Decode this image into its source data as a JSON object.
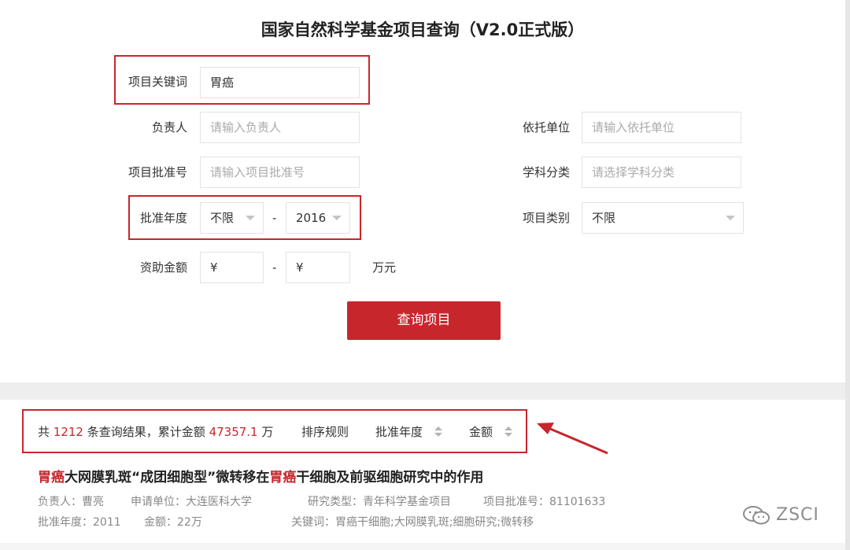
{
  "page": {
    "title": "国家自然科学基金项目查询（V2.0正式版）"
  },
  "form": {
    "keyword_label": "项目关键词",
    "keyword_value": "胃癌",
    "leader_label": "负责人",
    "leader_placeholder": "请输入负责人",
    "org_label": "依托单位",
    "org_placeholder": "请输入依托单位",
    "approval_no_label": "项目批准号",
    "approval_no_placeholder": "请输入项目批准号",
    "subject_label": "学科分类",
    "subject_placeholder": "请选择学科分类",
    "year_label": "批准年度",
    "year_from": "不限",
    "year_dash": "-",
    "year_to": "2016",
    "type_label": "项目类别",
    "type_value": "不限",
    "amount_label": "资助金额",
    "amount_from": "¥",
    "amount_dash": "-",
    "amount_to": "¥",
    "amount_unit": "万元",
    "submit_label": "查询项目"
  },
  "summary": {
    "prefix": "共",
    "count": "1212",
    "mid": "条查询结果，累计金额",
    "total": "47357.1",
    "suffix": "万",
    "sort_rule": "排序规则",
    "sort_year": "批准年度",
    "sort_amount": "金额"
  },
  "result": {
    "title_hl1": "胃癌",
    "title_part1": "大网膜乳斑“成团细胞型”微转移在",
    "title_hl2": "胃癌",
    "title_part2": "干细胞及前驱细胞研究中的作用",
    "leader": "负责人：曹亮",
    "org": "申请单位：大连医科大学",
    "research_type": "研究类型：青年科学基金项目",
    "approval_no": "项目批准号：81101633",
    "year": "批准年度：2011",
    "amount": "金额：22万",
    "keywords": "关键词：胃癌干细胞;大网膜乳斑;细胞研究;微转移"
  },
  "watermark": {
    "text": "ZSCI",
    "icon": "wechat-icon"
  },
  "colors": {
    "accent": "#c8262d",
    "placeholder": "#aaaaaa",
    "meta": "#888888"
  }
}
